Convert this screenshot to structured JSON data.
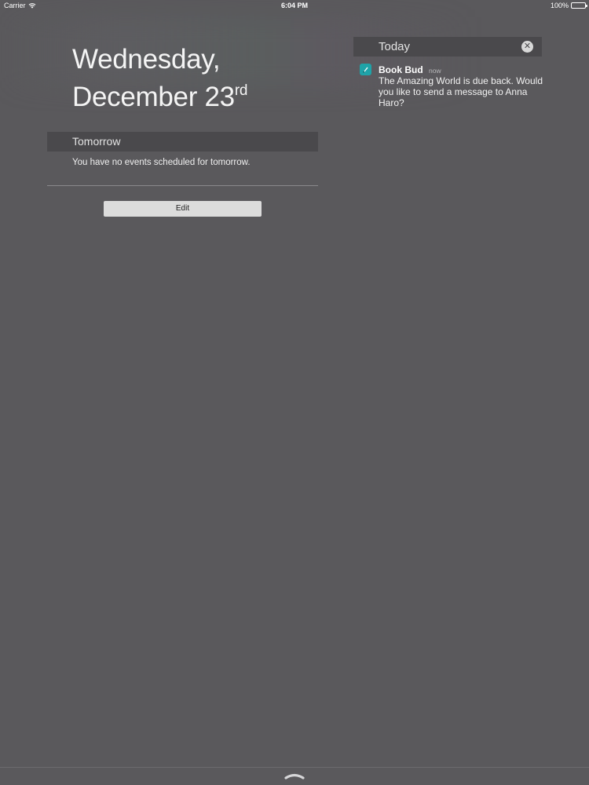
{
  "status_bar": {
    "carrier": "Carrier",
    "time": "6:04 PM",
    "battery": "100%",
    "battery_level": 1.0,
    "wifi_icon": "wifi-icon",
    "battery_icon": "battery-icon"
  },
  "date": {
    "weekday": "Wednesday,",
    "month_day": "December 23",
    "ordinal_suffix": "rd"
  },
  "tomorrow": {
    "title": "Tomorrow",
    "message": "You have no events scheduled for tomorrow."
  },
  "edit_label": "Edit",
  "today": {
    "title": "Today",
    "clear_icon": "close-icon",
    "clear_symbol": "✕",
    "notification": {
      "app_name": "Book Bud",
      "app_icon": "book-bud-app-icon",
      "time": "now",
      "message": "The Amazing World is due back. Would you like to send a message to Anna Haro?"
    }
  },
  "colors": {
    "background": "#5a595c",
    "section_header": "#4a494c",
    "app_icon": "#1fa3a8",
    "button": "#dcdcdc"
  },
  "grabber_icon": "chevron-up-icon"
}
